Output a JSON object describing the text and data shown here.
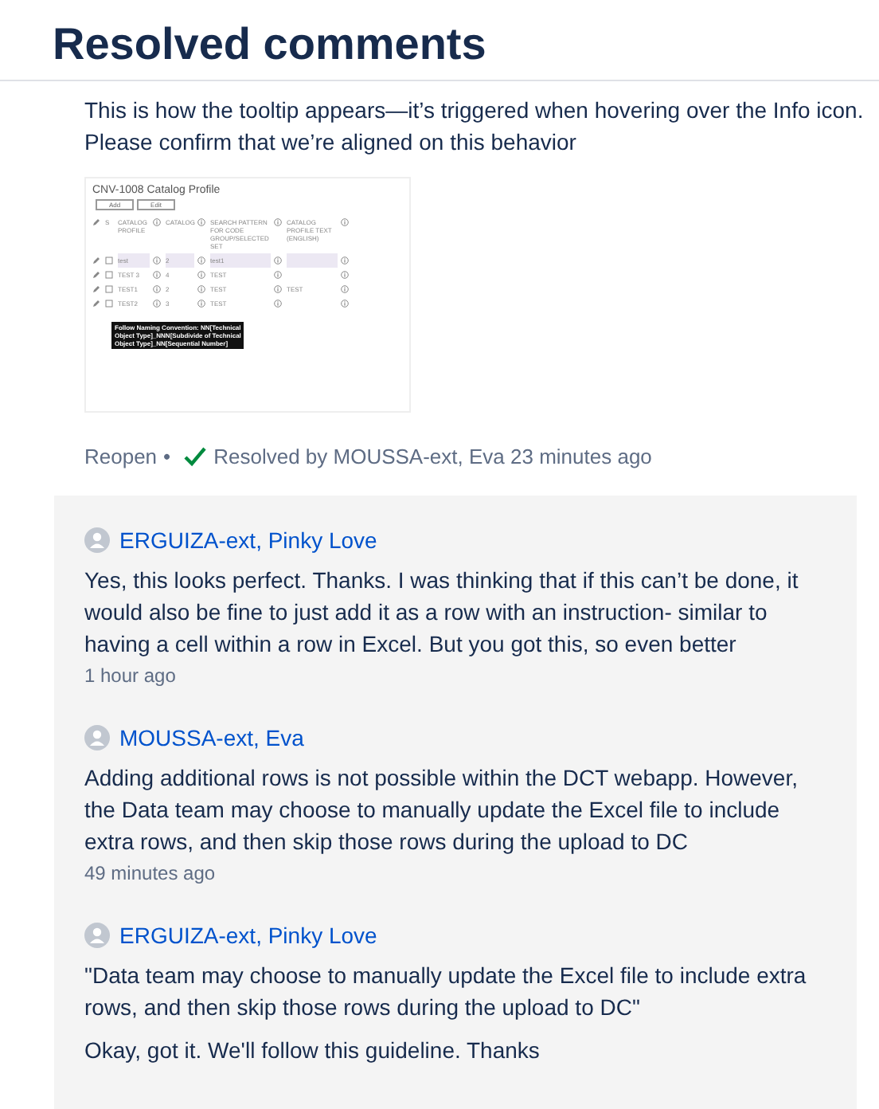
{
  "title": "Resolved comments",
  "comment": {
    "text": "This is how the tooltip appears—it’s triggered when hovering over the Info icon. Please confirm that we’re aligned on this behavior",
    "screenshot": {
      "title": "CNV-1008 Catalog Profile",
      "buttons": [
        "Add",
        "Edit"
      ],
      "select_header": "S",
      "columns": [
        "CATALOG PROFILE",
        "CATALOG",
        "SEARCH PATTERN FOR CODE GROUP/SELECTED SET",
        "CATALOG PROFILE TEXT (ENGLISH)"
      ],
      "rows": [
        {
          "cells": [
            "test",
            "2",
            "test1",
            ""
          ],
          "selected": true,
          "checked": false
        },
        {
          "cells": [
            "TEST 3",
            "4",
            "TEST",
            ""
          ],
          "selected": false,
          "checked": false
        },
        {
          "cells": [
            "TEST1",
            "2",
            "TEST",
            "TEST"
          ],
          "selected": false,
          "checked": false
        },
        {
          "cells": [
            "TEST2",
            "3",
            "TEST",
            ""
          ],
          "selected": false,
          "checked": false
        }
      ],
      "tooltip": [
        "Follow Naming Convention: NN[Technical",
        "Object Type]_NNN[Subdivide of Technical",
        "Object Type]_NN[Sequential Number]"
      ]
    },
    "reopen": "Reopen",
    "separator": "•",
    "resolved": "Resolved by MOUSSA-ext, Eva 23 minutes ago"
  },
  "replies": [
    {
      "author": "ERGUIZA-ext, Pinky Love",
      "body": [
        "Yes, this looks perfect. Thanks. I was thinking that if this can’t be done, it would also be fine to just add it as a row with an instruction- similar to having a cell within a row in Excel. But you got this, so even better"
      ],
      "time": "1 hour ago"
    },
    {
      "author": "MOUSSA-ext, Eva",
      "body": [
        "Adding additional rows is not possible within the DCT webapp. However, the Data team may choose to manually update the Excel file to include extra rows, and then skip those rows during the upload to DC"
      ],
      "time": "49 minutes ago"
    },
    {
      "author": "ERGUIZA-ext, Pinky Love",
      "body": [
        "\"Data team may choose to manually update the Excel file to include extra rows, and then skip those rows during the upload to DC\"",
        "Okay, got it. We'll follow this guideline. Thanks"
      ]
    }
  ]
}
